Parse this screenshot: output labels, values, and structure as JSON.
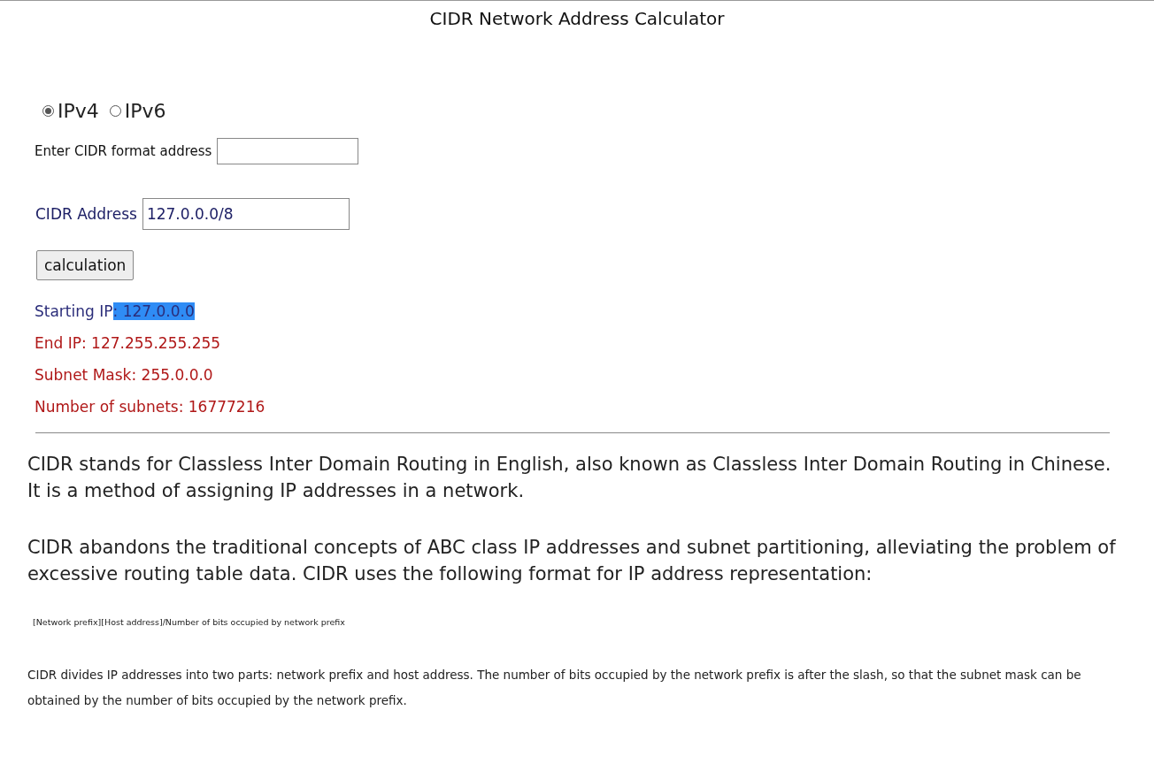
{
  "title": "CIDR Network Address Calculator",
  "ip_versions": [
    {
      "label": "IPv4",
      "selected": true
    },
    {
      "label": "IPv6",
      "selected": false
    }
  ],
  "enter_label": "Enter CIDR format address",
  "cidr_field": {
    "label": "CIDR Address",
    "value": "127.0.0.0/8"
  },
  "calculate_button": "calculation",
  "results": [
    {
      "text": "Starting IP",
      "highlighted_text": ": 127.0.0.0",
      "color": "#2b2d7a"
    },
    {
      "text": "End IP: 127.255.255.255",
      "color": "#b01818"
    },
    {
      "text": "Subnet Mask: 255.0.0.0",
      "color": "#b01818"
    },
    {
      "text": "Number of subnets: 16777216",
      "color": "#b01818"
    }
  ],
  "paragraphs": [
    {
      "kind": "large",
      "text": "CIDR stands for Classless Inter Domain Routing in English, also known as Classless Inter Domain Routing in Chinese. It is a method of assigning IP addresses in a network."
    },
    {
      "kind": "large",
      "text": "CIDR abandons the traditional concepts of ABC class IP addresses and subnet partitioning, alleviating the problem of excessive routing table data. CIDR uses the following format for IP address representation:"
    },
    {
      "kind": "tiny",
      "text": "[Network prefix][Host address]/Number of bits occupied by network prefix"
    },
    {
      "kind": "small",
      "text": "CIDR divides IP addresses into two parts: network prefix and host address. The number of bits occupied by the network prefix is after the slash, so that the subnet mask can be obtained by the number of bits occupied by the network prefix."
    }
  ]
}
